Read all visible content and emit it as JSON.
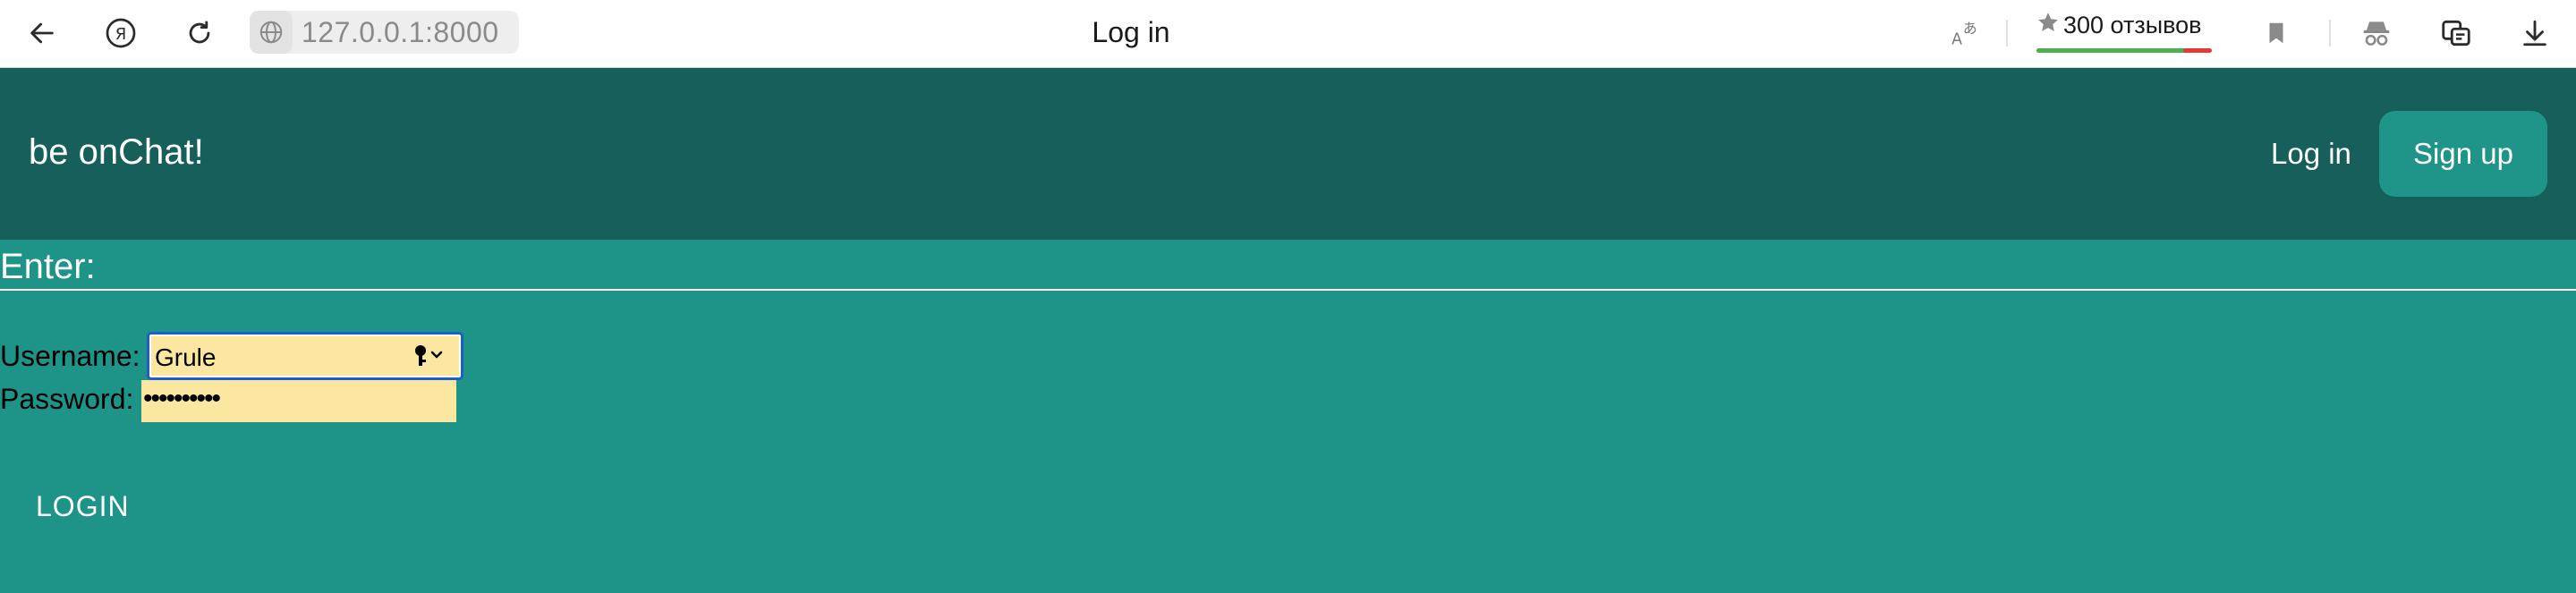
{
  "browser": {
    "address": "127.0.0.1:8000",
    "tab_title": "Log in",
    "reviews_label": "300 отзывов",
    "icons": [
      "back-icon",
      "yandex-icon",
      "reload-icon",
      "globe-icon",
      "translate-icon",
      "star-icon",
      "bookmark-icon",
      "incognito-icon",
      "reader-icon",
      "download-icon"
    ]
  },
  "navbar": {
    "brand": "be onChat!",
    "login_label": "Log in",
    "signup_label": "Sign up"
  },
  "form": {
    "heading": "Enter:",
    "username_label": "Username:",
    "username_value": "Grule",
    "password_label": "Password:",
    "password_value": "••••••••••",
    "submit_label": "LOGIN"
  },
  "colors": {
    "navbar_bg": "#175f5b",
    "content_bg": "#1e9488",
    "signup_bg": "#1f9488",
    "autofill_bg": "#fbe79f",
    "focus_border": "#1d5fc9"
  }
}
